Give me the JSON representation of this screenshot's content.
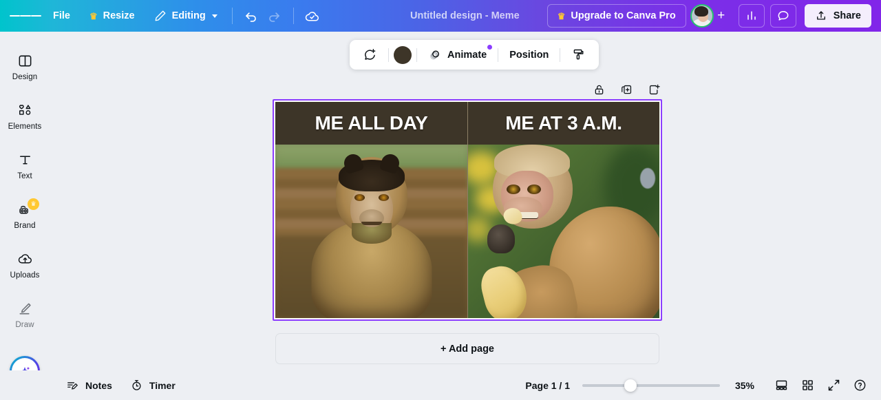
{
  "topbar": {
    "menu_icon": "hamburger-menu-icon",
    "file_label": "File",
    "resize_label": "Resize",
    "resize_icon": "crown-icon",
    "editing_label": "Editing",
    "editing_icon": "pencil-icon",
    "undo_icon": "undo-arrow-icon",
    "redo_icon": "redo-arrow-icon",
    "cloud_icon": "cloud-check-icon",
    "doc_title": "Untitled design - Meme",
    "upgrade_label": "Upgrade to Canva Pro",
    "upgrade_icon": "crown-icon",
    "avatar": "user-avatar",
    "add_collaborator_icon": "plus-icon",
    "insights_icon": "bar-chart-icon",
    "comments_icon": "comment-bubble-icon",
    "share_label": "Share",
    "share_icon": "upload-arrow-icon",
    "gradient_start": "#00C4CC",
    "gradient_end": "#8126E9"
  },
  "sidebar": {
    "items": [
      {
        "label": "Design",
        "icon": "design-panel-icon"
      },
      {
        "label": "Elements",
        "icon": "shapes-icon"
      },
      {
        "label": "Text",
        "icon": "text-t-icon"
      },
      {
        "label": "Brand",
        "icon": "brand-kit-icon",
        "badge": "crown-icon"
      },
      {
        "label": "Uploads",
        "icon": "cloud-upload-icon"
      },
      {
        "label": "Draw",
        "icon": "pen-draw-icon"
      }
    ],
    "magic_button": "magic-sparkle-icon"
  },
  "float_toolbar": {
    "comment_icon": "add-comment-icon",
    "color_swatch": "#3D3528",
    "animate_label": "Animate",
    "animate_icon": "animate-circles-icon",
    "animate_badge_color": "#8B3DFF",
    "position_label": "Position",
    "style_icon": "paint-roller-icon"
  },
  "canvas_controls": {
    "lock_icon": "unlock-icon",
    "duplicate_icon": "duplicate-page-icon",
    "add_page_icon": "add-page-icon"
  },
  "design": {
    "selection_color": "#8B3DFF",
    "caption_bg": "#3D3528",
    "panels": [
      {
        "caption": "ME ALL DAY",
        "image": "capuchin-monkey-photo"
      },
      {
        "caption": "ME AT 3 A.M.",
        "image": "macaque-eating-banana-photo"
      }
    ]
  },
  "add_page": {
    "label": "+ Add page"
  },
  "bottombar": {
    "notes_label": "Notes",
    "notes_icon": "notes-pencil-icon",
    "timer_label": "Timer",
    "timer_icon": "stopwatch-icon",
    "page_count": "Page 1 / 1",
    "zoom_value": "35%",
    "zoom_percent": 35,
    "presenter_icon": "presenter-view-icon",
    "grid_icon": "grid-view-icon",
    "fullscreen_icon": "fullscreen-expand-icon",
    "help_icon": "help-question-icon"
  }
}
